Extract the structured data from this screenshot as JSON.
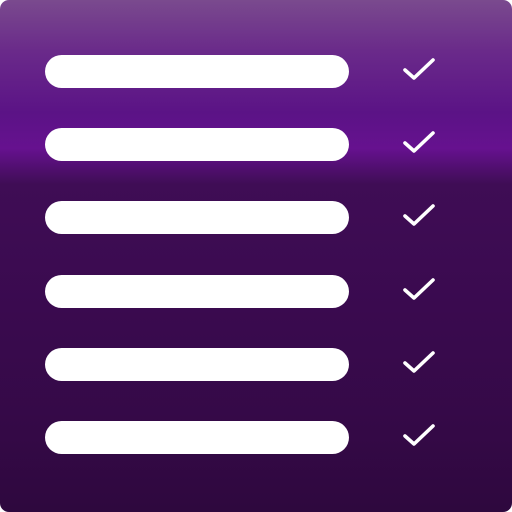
{
  "icon": {
    "colors": {
      "gradient_top": "#7a4a8e",
      "gradient_band": "#66118f",
      "gradient_bottom": "#2e083e",
      "bar": "#ffffff",
      "check": "#ffffff"
    },
    "rows": [
      {
        "checked": true,
        "icon": "check-icon"
      },
      {
        "checked": true,
        "icon": "check-icon"
      },
      {
        "checked": true,
        "icon": "check-icon"
      },
      {
        "checked": true,
        "icon": "check-icon"
      },
      {
        "checked": true,
        "icon": "check-icon"
      },
      {
        "checked": true,
        "icon": "check-icon"
      }
    ]
  }
}
